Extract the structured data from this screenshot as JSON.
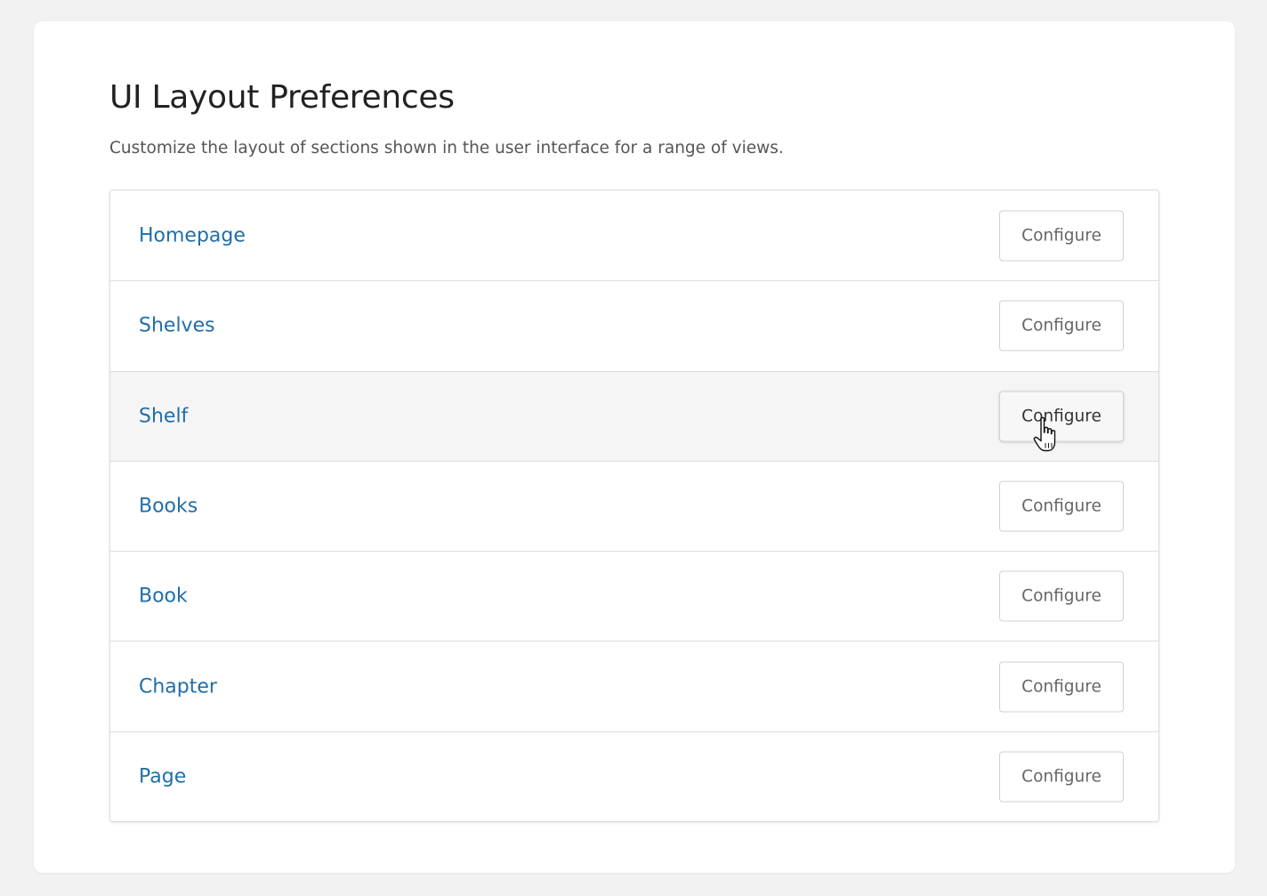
{
  "page": {
    "title": "UI Layout Preferences",
    "description": "Customize the layout of sections shown in the user interface for a range of views."
  },
  "views": [
    {
      "label": "Homepage",
      "button": "Configure"
    },
    {
      "label": "Shelves",
      "button": "Configure"
    },
    {
      "label": "Shelf",
      "button": "Configure",
      "hovered": true
    },
    {
      "label": "Books",
      "button": "Configure"
    },
    {
      "label": "Book",
      "button": "Configure"
    },
    {
      "label": "Chapter",
      "button": "Configure"
    },
    {
      "label": "Page",
      "button": "Configure"
    }
  ],
  "colors": {
    "background": "#f2f2f2",
    "card": "#ffffff",
    "link": "#206ea7",
    "hover_row": "#f5f5f5"
  },
  "cursor": {
    "icon": "hand-pointer-icon"
  }
}
